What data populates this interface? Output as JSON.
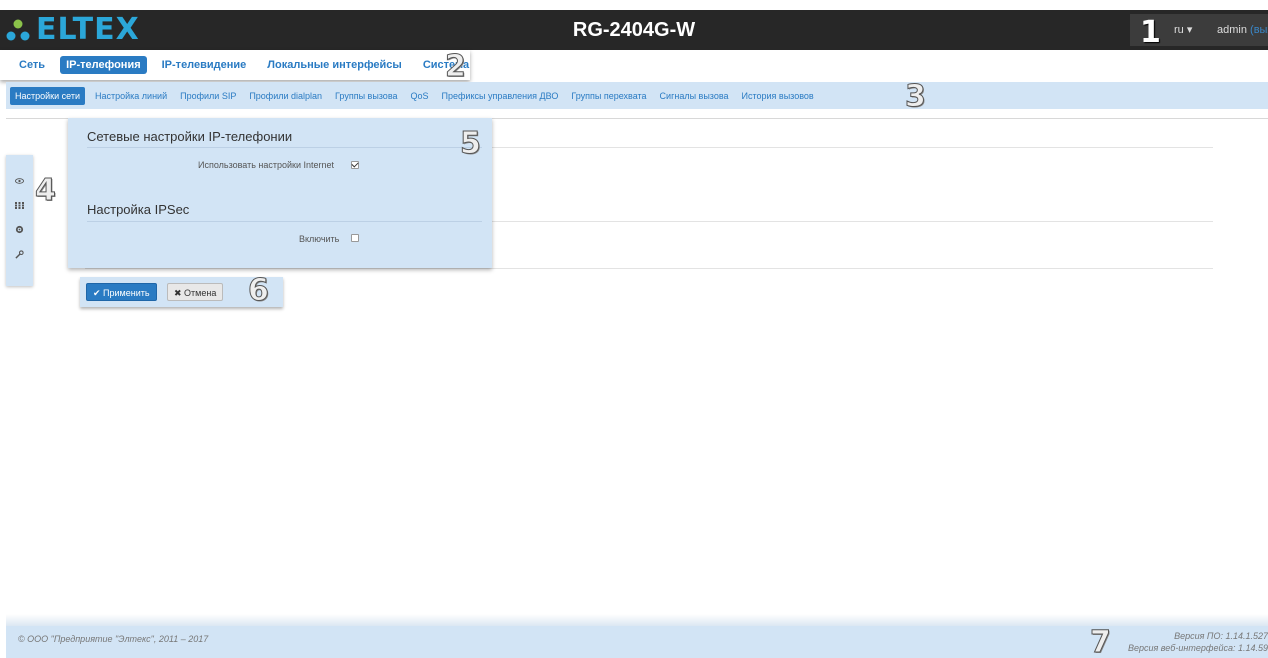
{
  "header": {
    "logo_text": "ELTEX",
    "device_name": "RG-2404G-W",
    "language": "ru",
    "username": "admin",
    "logout_label": "(выход)"
  },
  "main_nav": {
    "items": [
      "Сеть",
      "IP-телефония",
      "IP-телевидение",
      "Локальные интерфейсы",
      "Система"
    ],
    "active": "IP-телефония"
  },
  "sub_nav": {
    "items": [
      "Настройки сети",
      "Настройка линий",
      "Профили SIP",
      "Профили dialplan",
      "Группы вызова",
      "QoS",
      "Префиксы управления ДВО",
      "Группы перехвата",
      "Сигналы вызова",
      "История вызовов"
    ],
    "active": "Настройки сети"
  },
  "settings": {
    "section1_title": "Сетевые настройки IP-телефонии",
    "use_internet_label": "Использовать настройки Internet",
    "use_internet_checked": true,
    "section2_title": "Настройка IPSec",
    "enable_label": "Включить",
    "enable_checked": false
  },
  "buttons": {
    "apply_label": "✔ Применить",
    "cancel_label": "✖ Отмена"
  },
  "side_panel_icons": [
    "eye-icon",
    "grid-icon",
    "gear-icon",
    "wrench-icon"
  ],
  "callouts": [
    "1",
    "2",
    "3",
    "4",
    "5",
    "6",
    "7"
  ],
  "footer": {
    "copyright": "© ООО \"Предприятие \"Элтекс\", 2011 – 2017",
    "fw_version": "Версия ПО: 1.14.1.527",
    "web_version": "Версия веб-интерфейса: 1.14.59"
  },
  "colors": {
    "header_bg": "#272727",
    "accent": "#2a7bc3",
    "logo": "#2ba7d9",
    "panel_bg": "#d2e4f5"
  }
}
